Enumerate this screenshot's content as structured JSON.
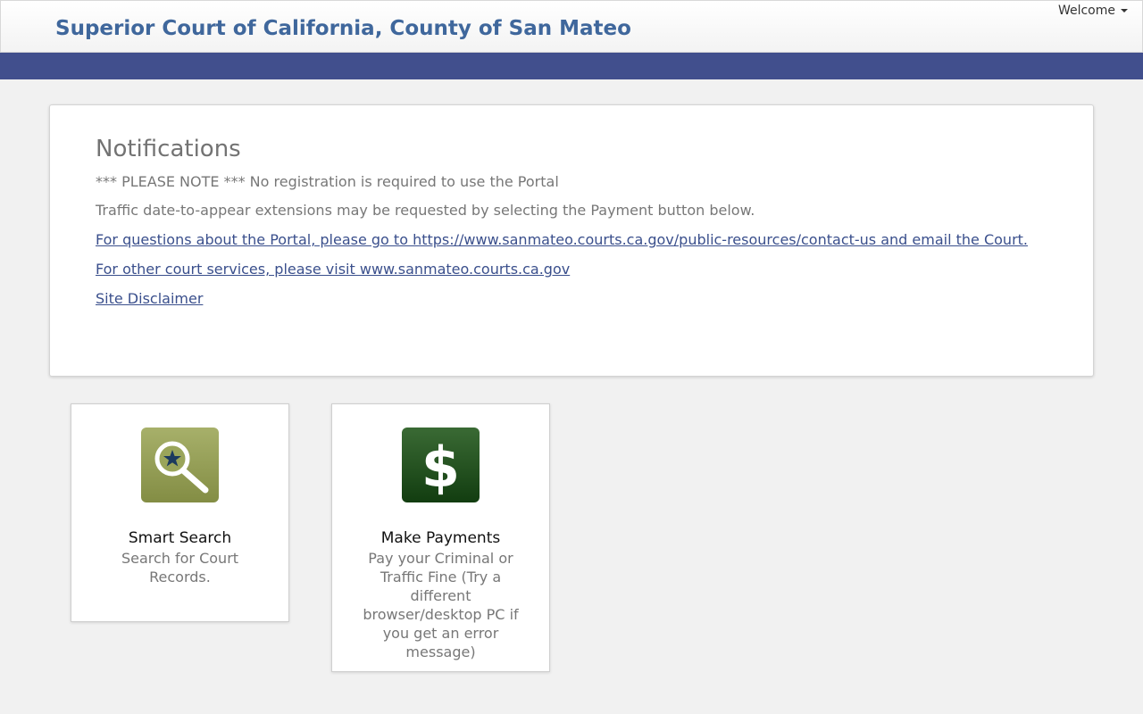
{
  "header": {
    "title": "Superior Court of California, County of San Mateo",
    "welcome_label": "Welcome"
  },
  "notifications": {
    "title": "Notifications",
    "note_registration": "*** PLEASE NOTE *** No registration is required to use the Portal",
    "note_traffic": "Traffic date-to-appear extensions may be requested by selecting the Payment button below.",
    "link_questions": "For questions about the Portal, please go to https://www.sanmateo.courts.ca.gov/public-resources/contact-us and email the Court.",
    "link_services": "For other court services, please visit www.sanmateo.courts.ca.gov",
    "link_disclaimer": "Site Disclaimer"
  },
  "tiles": [
    {
      "title": "Smart Search",
      "description": "Search for Court Records.",
      "icon": "magnifier-star-icon",
      "color": "#8f9a52"
    },
    {
      "title": "Make Payments",
      "description": "Pay your Criminal or Traffic Fine (Try a different browser/desktop PC if you get an error message)",
      "icon": "dollar-icon",
      "color": "#1f4a1c"
    }
  ],
  "colors": {
    "brand_title": "#3f679c",
    "navbar": "#414f8d",
    "link": "#3a4f8c",
    "background": "#f1f1f1"
  }
}
